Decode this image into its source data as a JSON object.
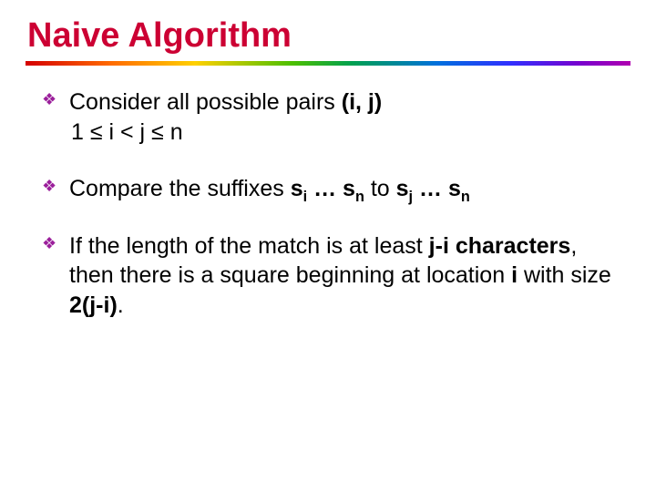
{
  "title": "Naive Algorithm",
  "bullets": {
    "b1": {
      "t1": "Consider all possible pairs ",
      "pair": "(i, j)",
      "line2": "1 ≤ i < j ≤ n"
    },
    "b2": {
      "t1": "Compare the suffixes ",
      "s": "s",
      "i": "i",
      "ell": " … ",
      "n": "n",
      "to": " to ",
      "j": "j"
    },
    "b3": {
      "t1": "If the length of the match is at least ",
      "ji1": "j-i characters",
      "t2": ",  then there is a square beginning at location ",
      "loc": "i",
      "t3": " with size ",
      "size": "2(j-i)",
      "dot": "."
    }
  }
}
